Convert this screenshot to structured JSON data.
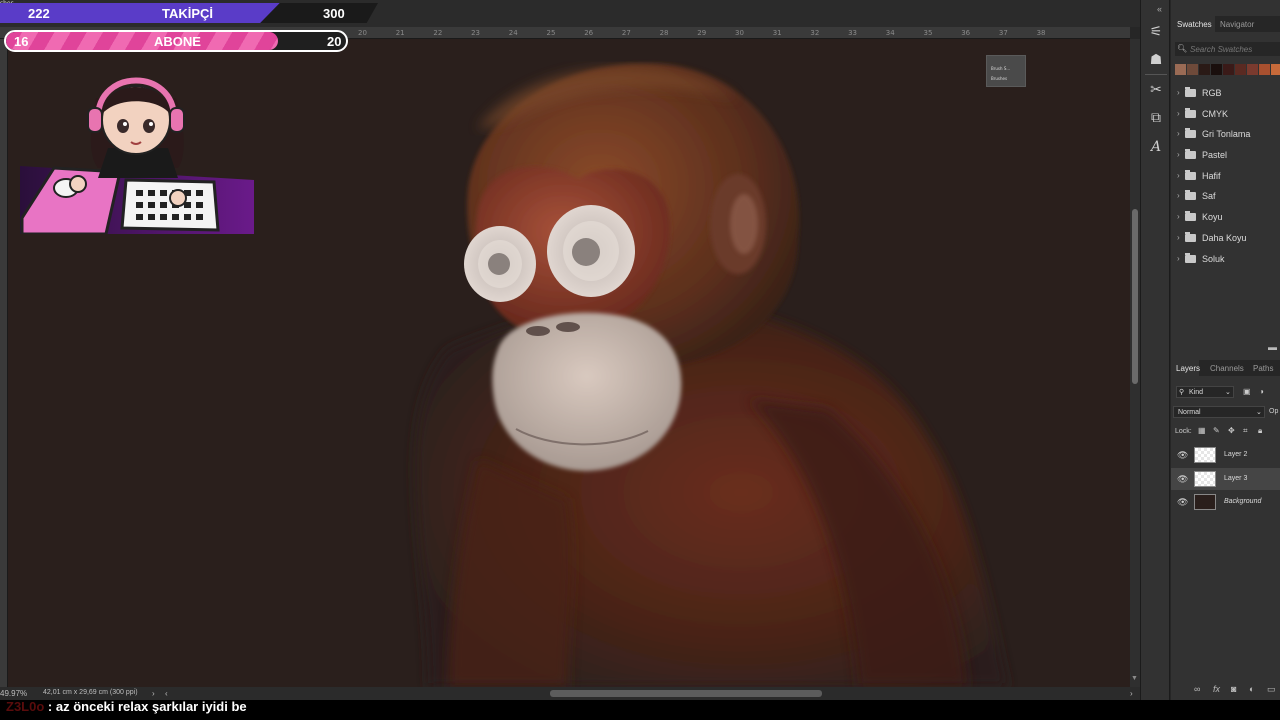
{
  "stream": {
    "followers": {
      "label": "TAKİPÇİ",
      "current": "222",
      "goal": "300",
      "progress": 0.74,
      "fill_color": "#5a3cc8"
    },
    "subscribers": {
      "label": "ABONE",
      "current": "16",
      "goal": "20",
      "progress": 0.8,
      "fill_color": "#e0449a"
    }
  },
  "tab_fragment": "shes",
  "ruler": {
    "ticks": [
      "20",
      "21",
      "22",
      "23",
      "24",
      "25",
      "26",
      "27",
      "28",
      "29",
      "30",
      "31",
      "32",
      "33",
      "34",
      "35",
      "36",
      "37",
      "38"
    ]
  },
  "canvas": {
    "background": "#2a1f1c",
    "subject": "orangutan painting"
  },
  "floating_panel": {
    "items": [
      "Brush S...",
      "Brushes"
    ]
  },
  "status": {
    "zoom": "49.97%",
    "doc_size": "42,01 cm x 29,69 cm (300 ppi)"
  },
  "chat": {
    "user": "Z3L0o",
    "separator": " : ",
    "message": "az önceki relax şarkılar iyidi be"
  },
  "tools": [
    "properties-icon",
    "libraries-icon",
    "tools-icon",
    "adjustments-icon",
    "type-icon"
  ],
  "swatches_panel": {
    "tabs": [
      "Swatches",
      "Navigator"
    ],
    "search_placeholder": "Search Swatches",
    "recent_colors": [
      "#9a6b55",
      "#6e4a3a",
      "#2a1a16",
      "#1a0f0d",
      "#3a1a18",
      "#5a2a22",
      "#7a3a2e",
      "#a8502f",
      "#c76a3a"
    ],
    "groups": [
      "RGB",
      "CMYK",
      "Gri Tonlama",
      "Pastel",
      "Hafif",
      "Saf",
      "Koyu",
      "Daha Koyu",
      "Soluk"
    ]
  },
  "layers_panel": {
    "tabs": [
      "Layers",
      "Channels",
      "Paths"
    ],
    "kind_label": "Kind",
    "blend_mode": "Normal",
    "opacity_label": "Op",
    "lock_label": "Lock:",
    "layers": [
      {
        "name": "Layer 2",
        "selected": false,
        "thumb": "checker",
        "italic": false
      },
      {
        "name": "Layer 3",
        "selected": true,
        "thumb": "checker",
        "italic": false
      },
      {
        "name": "Background",
        "selected": false,
        "thumb": "dark",
        "italic": true
      }
    ],
    "bottom_icons": [
      "link-icon",
      "fx-icon",
      "mask-icon",
      "adjustment-layer-icon",
      "new-group-icon"
    ]
  }
}
